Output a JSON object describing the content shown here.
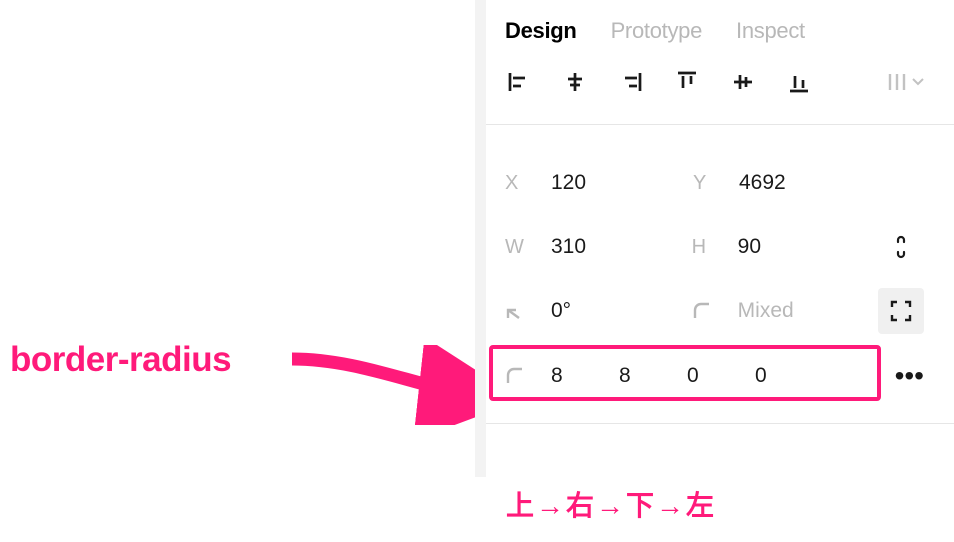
{
  "tabs": {
    "design": "Design",
    "prototype": "Prototype",
    "inspect": "Inspect"
  },
  "props": {
    "x_label": "X",
    "x_value": "120",
    "y_label": "Y",
    "y_value": "4692",
    "w_label": "W",
    "w_value": "310",
    "h_label": "H",
    "h_value": "90",
    "rot_value": "0°",
    "radius_value": "Mixed"
  },
  "radius_corners": {
    "tl": "8",
    "tr": "8",
    "br": "0",
    "bl": "0"
  },
  "annotation": {
    "label": "border-radius",
    "hint": "上→右→下→左"
  }
}
